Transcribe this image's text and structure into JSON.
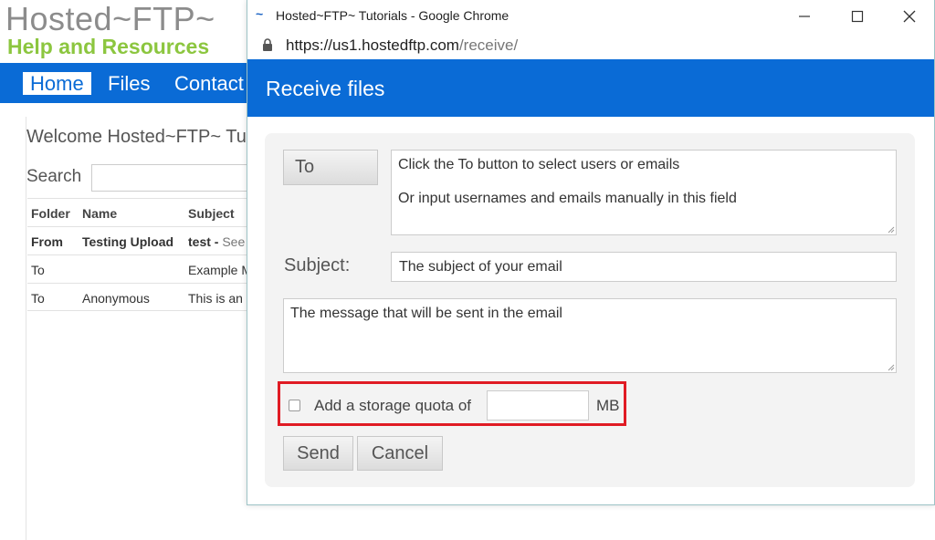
{
  "background_page": {
    "logo": {
      "title": "Hosted~FTP~",
      "subtitle": "Help and Resources"
    },
    "nav": [
      {
        "label": "Home",
        "active": true
      },
      {
        "label": "Files",
        "active": false
      },
      {
        "label": "Contact",
        "active": false
      }
    ],
    "welcome": "Welcome Hosted~FTP~ Tu",
    "search_label": "Search",
    "table": {
      "headers": [
        "Folder",
        "Name",
        "Subject"
      ],
      "rows": [
        {
          "folder": "From",
          "name": "Testing Upload",
          "subject_bold": "test - ",
          "subject_rest": "See"
        },
        {
          "folder": "To",
          "name": "",
          "subject_bold": "",
          "subject_rest": "Example M"
        },
        {
          "folder": "To",
          "name": "Anonymous",
          "subject_bold": "",
          "subject_rest": "This is an"
        }
      ]
    }
  },
  "browser": {
    "window_title": "Hosted~FTP~ Tutorials - Google Chrome",
    "favicon": "~",
    "url_host": "https://us1.hostedftp.com",
    "url_path": "/receive/",
    "controls": {
      "minimize_icon": "minimize-icon",
      "maximize_icon": "maximize-icon",
      "close_icon": "close-icon"
    }
  },
  "dialog": {
    "title": "Receive files",
    "to_button": "To",
    "to_placeholder_line1": "Click the To button to select users or emails",
    "to_placeholder_line2": "Or input usernames and emails manually in this field",
    "subject_label": "Subject:",
    "subject_placeholder": "The subject of your email",
    "message_placeholder": "The message that will be sent in the email",
    "quota_label": "Add a storage quota of",
    "quota_value": "",
    "quota_unit": "MB",
    "quota_checked": false,
    "send_button": "Send",
    "cancel_button": "Cancel"
  },
  "colors": {
    "brand_blue": "#0a6bd6",
    "logo_green": "#8cc63f",
    "highlight_red": "#e01b24"
  }
}
